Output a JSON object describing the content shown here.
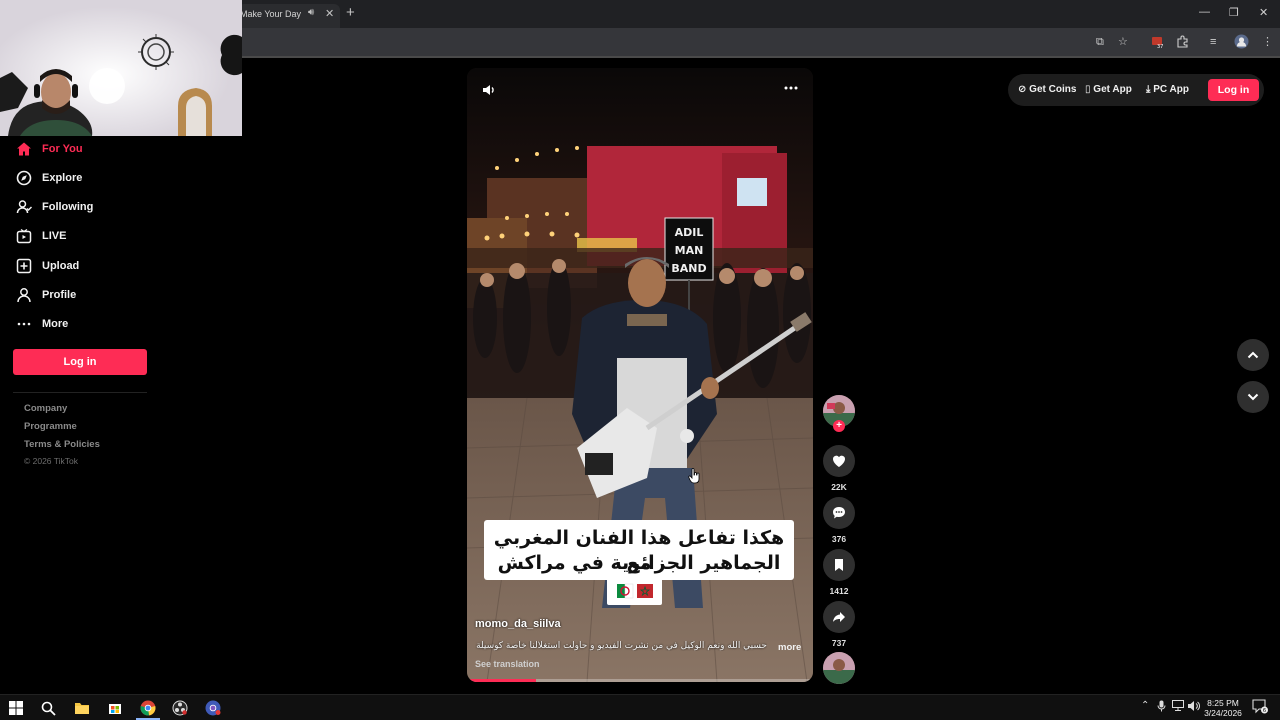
{
  "browser": {
    "tab_title": "Make Your Day",
    "tab_audio_icon": "speaker-icon",
    "tab_close_icon": "close-icon",
    "new_tab_icon": "plus-icon",
    "extension_badge": "37"
  },
  "sidebar": {
    "items": [
      {
        "label": "For You",
        "icon": "home-icon",
        "active": true
      },
      {
        "label": "Explore",
        "icon": "compass-icon",
        "active": false
      },
      {
        "label": "Following",
        "icon": "following-icon",
        "active": false
      },
      {
        "label": "LIVE",
        "icon": "live-tv-icon",
        "active": false
      },
      {
        "label": "Upload",
        "icon": "upload-plus-icon",
        "active": false
      },
      {
        "label": "Profile",
        "icon": "profile-icon",
        "active": false
      },
      {
        "label": "More",
        "icon": "more-dots-icon",
        "active": false
      }
    ],
    "login_label": "Log in",
    "footer": {
      "company": "Company",
      "programme": "Programme",
      "terms": "Terms & Policies",
      "copyright": "© 2026 TikTok"
    }
  },
  "header": {
    "get_coins": "Get Coins",
    "get_app": "Get App",
    "pc_app": "PC App",
    "login": "Log in"
  },
  "video": {
    "sign_text": [
      "ADIL",
      "MAN",
      "BAND"
    ],
    "caption_line1": "هكذا تفاعل هذا الفنان المغربي مع",
    "caption_line2": "الجماهير الجزائرية في مراكش",
    "username": "momo_da_siilva",
    "description": "حسبي الله ونعم الوكيل في من نشرت الفيديو و حاولت استغلالنا خاصة كوسيلة",
    "more_label": "more",
    "see_translation": "See translation",
    "progress": 0.2
  },
  "actions": {
    "likes": "22K",
    "comments": "376",
    "saves": "1412",
    "shares": "737"
  },
  "taskbar": {
    "time": "8:25 PM",
    "date": "3/24/2026",
    "notification_count": "6"
  },
  "colors": {
    "accent": "#fe2c55",
    "background": "#000000",
    "taskbar": "#101010"
  }
}
